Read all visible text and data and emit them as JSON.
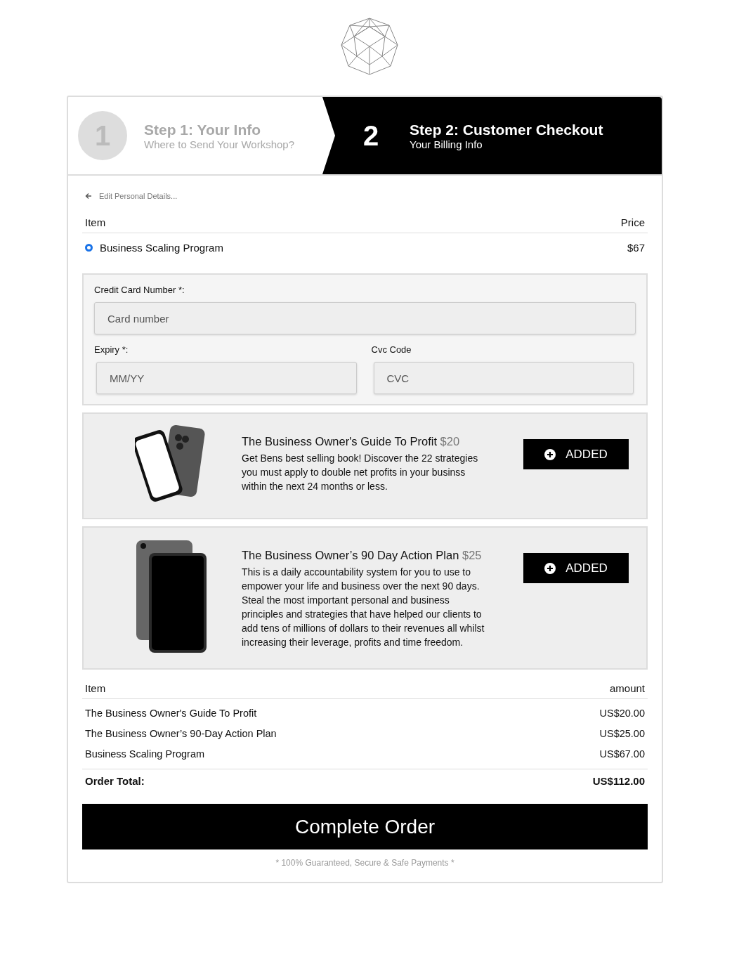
{
  "steps": [
    {
      "number": "1",
      "title": "Step 1: Your Info",
      "subtitle": "Where to Send Your Workshop?",
      "selected": false
    },
    {
      "number": "2",
      "title": "Step 2: Customer Checkout",
      "subtitle": "Your Billing Info",
      "selected": true
    }
  ],
  "back_link": "Edit Personal Details...",
  "items_table": {
    "columns": [
      "Item",
      "Price"
    ],
    "rows": [
      {
        "name": "Business Scaling Program",
        "price": "$67",
        "selected": true
      }
    ]
  },
  "payment": {
    "card_label": "Credit Card Number *:",
    "card_placeholder": "Card number",
    "expiry_label": "Expiry *:",
    "expiry_placeholder": "MM/YY",
    "cvc_label": "Cvc Code",
    "cvc_placeholder": "CVC"
  },
  "offers": [
    {
      "kind": "phone",
      "title": "The Business Owner's Guide To Profit",
      "price": "$20",
      "description": "Get Bens best selling book! Discover the 22 strategies you must apply to double net profits in your businss within the next 24 months or less.",
      "button": "ADDED"
    },
    {
      "kind": "tablet",
      "title": "The Business Owner’s 90 Day Action Plan",
      "price": "$25",
      "description": "This is a daily accountability system for you to use to empower your life and business over the next 90 days. Steal the most important personal and business principles and strategies that have helped our clients to add tens of millions of dollars to their revenues all whilst increasing their leverage, profits and time freedom.",
      "button": "ADDED"
    }
  ],
  "summary": {
    "columns": [
      "Item",
      "amount"
    ],
    "rows": [
      {
        "name": "The Business Owner's Guide To Profit",
        "amount": "US$20.00"
      },
      {
        "name": "The Business Owner’s 90-Day Action Plan",
        "amount": "US$25.00"
      },
      {
        "name": "Business Scaling Program",
        "amount": "US$67.00"
      }
    ],
    "total_label": "Order Total:",
    "total": "US$112.00"
  },
  "submit": "Complete Order",
  "footnote": "* 100% Guaranteed, Secure & Safe Payments *"
}
